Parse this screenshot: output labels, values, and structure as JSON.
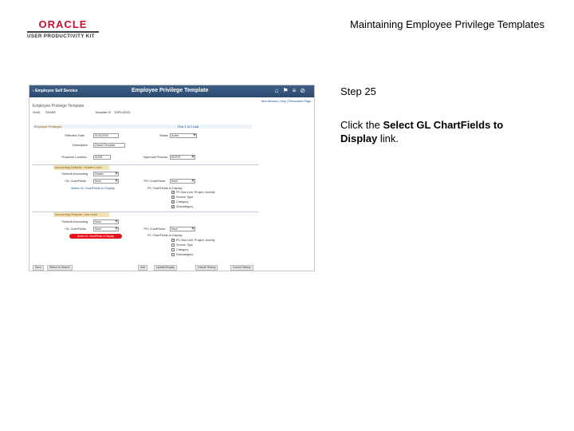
{
  "slide": {
    "logo_brand": "ORACLE",
    "logo_product": "USER PRODUCTIVITY KIT",
    "title": "Maintaining Employee Privilege Templates"
  },
  "step": {
    "label": "Step 25",
    "instruction_prefix": "Click the ",
    "instruction_bold": "Select GL ChartFields to Display",
    "instruction_suffix": " link."
  },
  "screenshot": {
    "back_label": "Employee Self Service",
    "page_title": "Employee Privilege Template",
    "icons": [
      "home-icon",
      "flag-icon",
      "menu-icon",
      "compass-icon"
    ],
    "nav_links": "New Window | Help | Personalize Page",
    "page_heading": "Employee Privilege Template",
    "setid_label": "SetID",
    "setid_value": "SHARE",
    "template_label": "Template ID",
    "template_value": "TMPL00001",
    "grid_title": "Employee Privileges",
    "grid_nav": "First  1 of 1  Last",
    "effdate_label": "*Effective Date",
    "effdate_value": "01/01/2000",
    "status_label": "Status",
    "status_value": "Active",
    "description_label": "Description",
    "description_value": "Default Template",
    "expense_label": "*Expense Location",
    "expense_value": "NONE",
    "approval_label": "*Approval Process",
    "approval_value": "RESTR",
    "acct_section": "Accounting Defaults",
    "acct_tab": "Header Level",
    "default_acct_label": "*Default Accounting",
    "default_acct_value": "Header",
    "gl_chartfields_label": "*GL ChartFields",
    "gl_chartfields_value": "None",
    "pc_chartfields_label": "*PC ChartFields",
    "pc_chartfields_value": "None",
    "select_gl_link": "Select GL ChartFields to Display",
    "pc_fields_heading": "PC ChartFields to Display",
    "pc_fields": [
      {
        "label": "PC Bus Unit, Project, Activity",
        "checked": true
      },
      {
        "label": "Source Type",
        "checked": true
      },
      {
        "label": "Category",
        "checked": true
      },
      {
        "label": "Subcategory",
        "checked": true
      }
    ],
    "line_section": "Accounting Defaults",
    "line_tab": "Line Level",
    "line_default_label": "*Default Accounting",
    "line_default_value": "None",
    "line_gl_label": "*GL ChartFields",
    "line_gl_value": "None",
    "line_pc_label": "*PC ChartFields",
    "line_pc_value": "None",
    "highlight_link": "Select GL ChartFields to Display",
    "line_pc_heading": "PC ChartFields to Display",
    "line_pc_fields": [
      {
        "label": "PC Bus Unit, Project, Activity",
        "checked": true
      },
      {
        "label": "Source Type",
        "checked": false
      },
      {
        "label": "Category",
        "checked": false
      },
      {
        "label": "Subcategory",
        "checked": false
      }
    ],
    "buttons": {
      "save": "Save",
      "return": "Return to Search",
      "add": "Add",
      "update": "Update/Display",
      "include_history": "Include History",
      "correct_history": "Correct History"
    }
  },
  "colors": {
    "header_blue": "#2c4a70",
    "highlight_red": "#e8101a",
    "oracle_red": "#c8102e"
  }
}
